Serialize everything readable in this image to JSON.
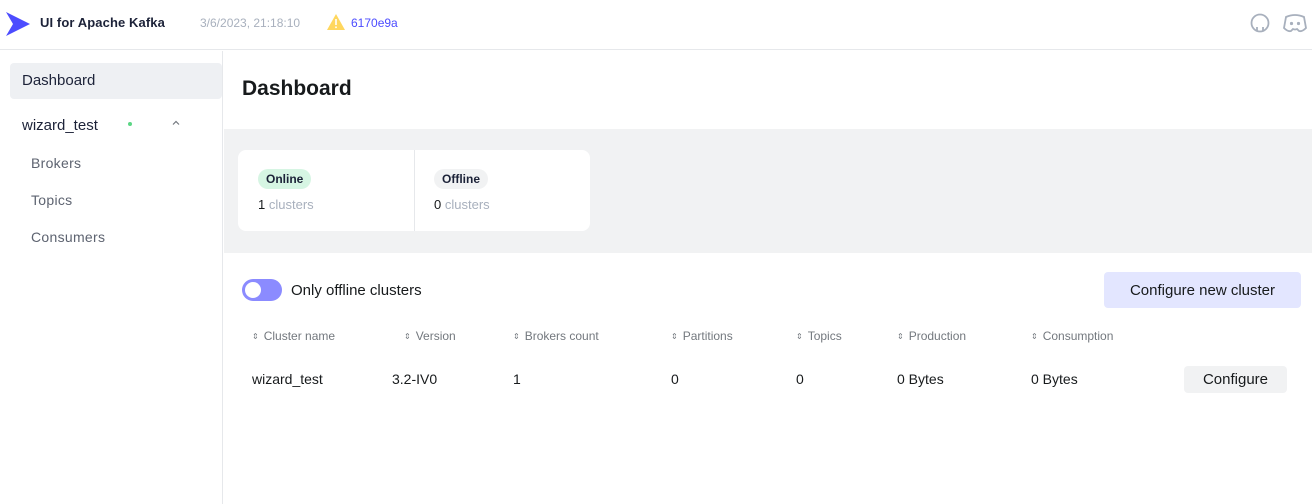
{
  "navbar": {
    "app_title": "UI for Apache Kafka",
    "build_date": "3/6/2023, 21:18:10",
    "commit": "6170e9a",
    "logo_icon": "kafka-ui-logo",
    "warning_icon": "warning-icon",
    "github_icon": "github-icon",
    "discord_icon": "discord-icon",
    "colors": {
      "logo": "#4c4cff",
      "commit_link": "#4c4cff",
      "warning": "#ffd75e"
    }
  },
  "sidebar": {
    "dashboard_label": "Dashboard",
    "cluster": {
      "name": "wizard_test",
      "status_color": "#5cd685",
      "items": [
        {
          "label": "Brokers"
        },
        {
          "label": "Topics"
        },
        {
          "label": "Consumers"
        }
      ]
    }
  },
  "main": {
    "title": "Dashboard",
    "stats": {
      "online": {
        "label": "Online",
        "count": "1",
        "unit": "clusters"
      },
      "offline": {
        "label": "Offline",
        "count": "0",
        "unit": "clusters"
      }
    },
    "filter": {
      "label": "Only offline clusters",
      "checked": false
    },
    "configure_new_label": "Configure new cluster",
    "table": {
      "headers": [
        "Cluster name",
        "Version",
        "Brokers count",
        "Partitions",
        "Topics",
        "Production",
        "Consumption"
      ],
      "rows": [
        {
          "cluster_name": "wizard_test",
          "version": "3.2-IV0",
          "brokers_count": "1",
          "partitions": "0",
          "topics": "0",
          "production": "0 Bytes",
          "consumption": "0 Bytes",
          "action": "Configure"
        }
      ]
    }
  }
}
